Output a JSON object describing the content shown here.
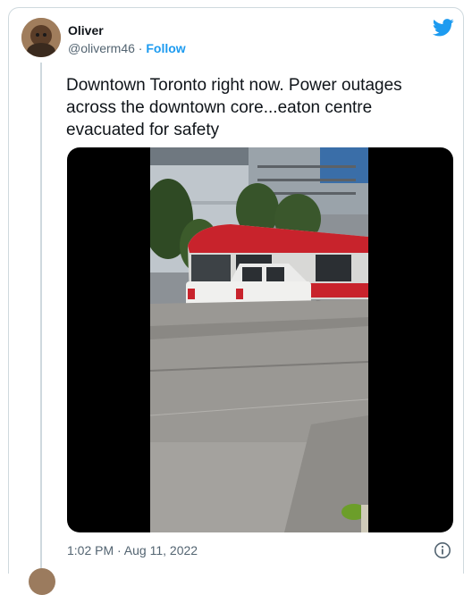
{
  "tweet": {
    "author_name": "Oliver",
    "handle": "@oliverm46",
    "separator": " · ",
    "follow_label": "Follow",
    "text": "Downtown Toronto right now. Power outages across the downtown core...eaton centre evacuated for safety",
    "timestamp": "1:02 PM · Aug 11, 2022"
  },
  "colors": {
    "accent": "#1d9bf0",
    "secondary_text": "#536471",
    "border": "#cfd9de"
  },
  "icons": {
    "brand": "twitter-bird-icon",
    "info": "info-icon"
  }
}
